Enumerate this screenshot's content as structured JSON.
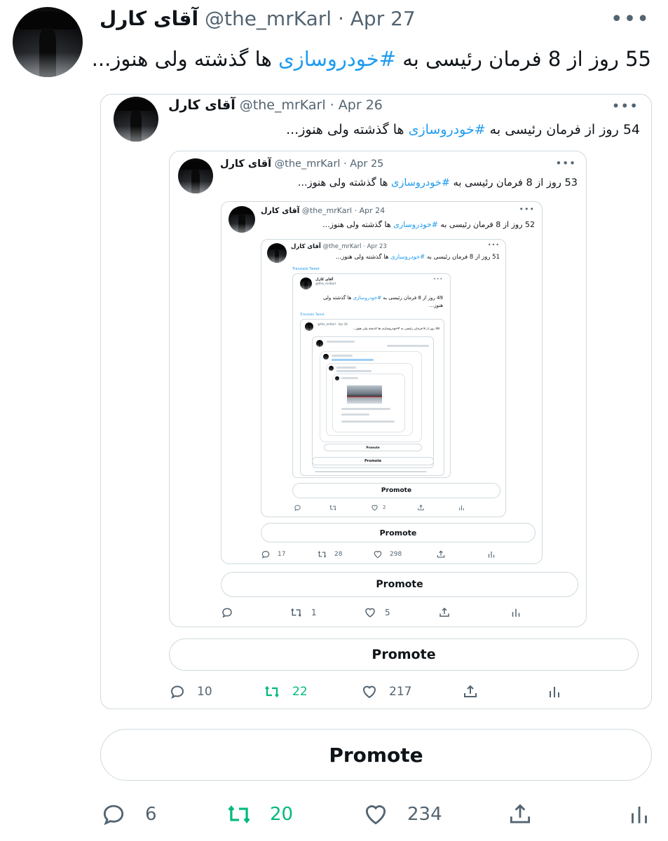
{
  "tweet": {
    "author_name": "آقای کارل",
    "handle": "@the_mrKarl",
    "date": "Apr 27",
    "text_prefix": "55 روز از 8 فرمان رئیسی به ",
    "hashtag": "#خودروسازی",
    "text_suffix": " ها گذشته ولی هنوز...",
    "promote_label": "Promote",
    "replies": "6",
    "retweets": "20",
    "likes": "234"
  },
  "quote1": {
    "author_name": "آقای کارل",
    "handle": "@the_mrKarl",
    "date": "Apr 26",
    "text_prefix": "54 روز از فرمان رئیسی به ",
    "hashtag": "#خودروسازی",
    "text_suffix": " ها گذشته ولی هنوز...",
    "promote_label": "Promote",
    "replies": "10",
    "retweets": "22",
    "likes": "217"
  },
  "quote2": {
    "author_name": "آقای کارل",
    "handle": "@the_mrKarl",
    "date": "Apr 25",
    "text_prefix": "53 روز از 8 فرمان رئیسی به ",
    "hashtag": "#خودروسازی",
    "text_suffix": " ها گذشته ولی هنوز...",
    "promote_label": "Promote",
    "replies": "",
    "retweets": "1",
    "likes": "5"
  },
  "quote3": {
    "author_name": "آقای کارل",
    "handle": "@the_mrKarl",
    "date": "Apr 24",
    "text_prefix": "52 روز از 8 فرمان رئیسی به ",
    "hashtag": "#خودروسازی",
    "text_suffix": " ها گذشته ولی هنوز...",
    "promote_label": "Promote",
    "replies": "17",
    "retweets": "28",
    "likes": "298"
  },
  "quote4": {
    "author_name": "آقای کارل",
    "handle": "@the_mrKarl",
    "date": "Apr 23",
    "text_prefix": "51 روز از 8 فرمان رئیسی به ",
    "hashtag": "#خودروسازی",
    "text_suffix": " ها گذشته ولی هنوز...",
    "translate_label": "Translate Tweet",
    "promote_label": "Promote",
    "replies": "",
    "retweets": "",
    "likes": "2"
  },
  "quote5": {
    "author_name": "آقای کارل",
    "handle": "@the_mrKarl",
    "text_prefix": "49 روز از 8 فرمان رئیسی به ",
    "hashtag": "#خودروسازی",
    "text_suffix": " ها گذشته ولی",
    "text_line2": "هنوز...",
    "translate_label": "Translate Tweet",
    "promote_label": "Promote"
  },
  "quote6": {
    "meta": "@the_mrKarl · Apr 26",
    "text": "48 روز از 8 فرمان رئیسی به #خودروسازی ها گذشته ولی هنوز...",
    "promote_label": "Promote"
  },
  "quote7": {
    "promote_label": "Promote"
  },
  "colors": {
    "accent_blue": "#1d9bf0",
    "retweet_green": "#00ba7c",
    "border": "#cfd9de",
    "secondary_text": "#536471"
  },
  "icons": [
    "reply-icon",
    "retweet-icon",
    "like-icon",
    "share-icon",
    "analytics-icon",
    "more-icon"
  ]
}
